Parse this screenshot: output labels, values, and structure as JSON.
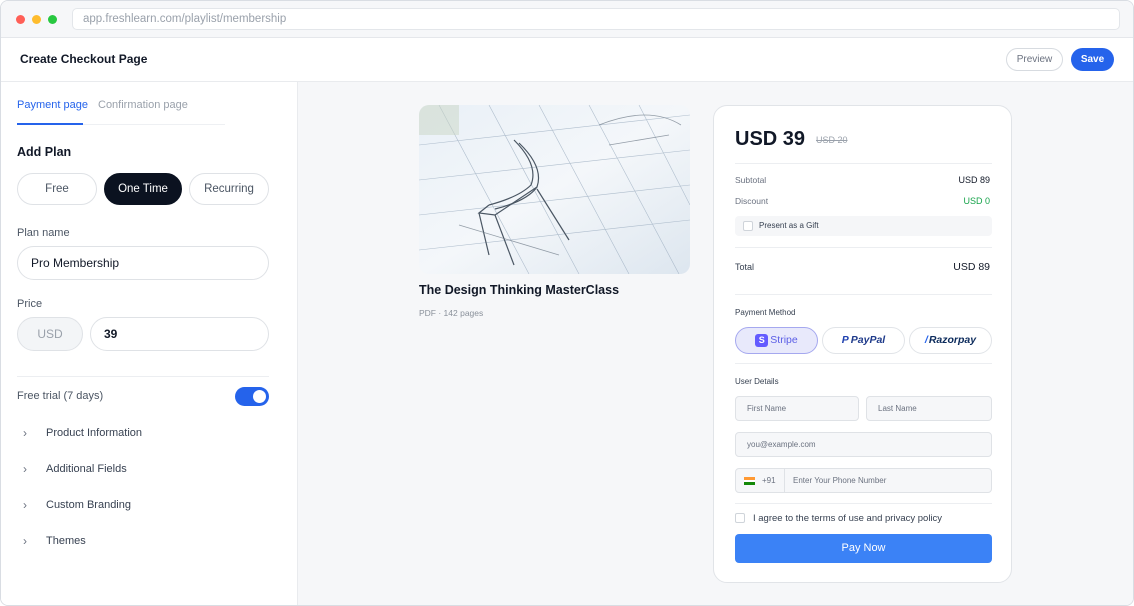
{
  "browser": {
    "url": "app.freshlearn.com/playlist/membership"
  },
  "header": {
    "title": "Create Checkout Page",
    "preview_label": "Preview",
    "save_label": "Save"
  },
  "left_panel": {
    "tabs": [
      {
        "label": "Payment page",
        "active": true
      },
      {
        "label": "Confirmation page",
        "active": false
      }
    ],
    "add_plan_title": "Add Plan",
    "plan_types": [
      {
        "label": "Free",
        "selected": false
      },
      {
        "label": "One Time",
        "selected": true
      },
      {
        "label": "Recurring",
        "selected": false
      }
    ],
    "plan_name_label": "Plan name",
    "plan_name_value": "Pro Membership",
    "price_label": "Price",
    "currency": "USD",
    "price_value": "39",
    "free_trial_label": "Free trial (7 days)",
    "free_trial_enabled": true,
    "accordion": [
      {
        "label": "Product Information"
      },
      {
        "label": "Additional Fields"
      },
      {
        "label": "Custom Branding"
      },
      {
        "label": "Themes"
      }
    ]
  },
  "preview": {
    "product_title": "The Design Thinking MasterClass",
    "product_meta": "PDF · 142 pages",
    "checkout": {
      "price": "USD 39",
      "original_price": "USD 20",
      "subtotal_label": "Subtotal",
      "subtotal_value": "USD 89",
      "discount_label": "Discount",
      "discount_value": "USD 0",
      "gift_label": "Present as a Gift",
      "total_label": "Total",
      "total_value": "USD 89",
      "payment_method_label": "Payment Method",
      "payment_methods": [
        {
          "name": "Stripe",
          "selected": true
        },
        {
          "name": "PayPal",
          "selected": false
        },
        {
          "name": "Razorpay",
          "selected": false
        }
      ],
      "user_details_label": "User Details",
      "first_name_placeholder": "First Name",
      "last_name_placeholder": "Last Name",
      "email_placeholder": "you@example.com",
      "dial_code": "+91",
      "phone_placeholder": "Enter Your Phone Number",
      "terms_label": "I agree to the terms of use and privacy policy",
      "pay_button_label": "Pay Now"
    }
  },
  "colors": {
    "accent": "#2563eb",
    "pay_button": "#3b82f6",
    "discount_green": "#16a34a",
    "dark_selected": "#0b1220"
  }
}
